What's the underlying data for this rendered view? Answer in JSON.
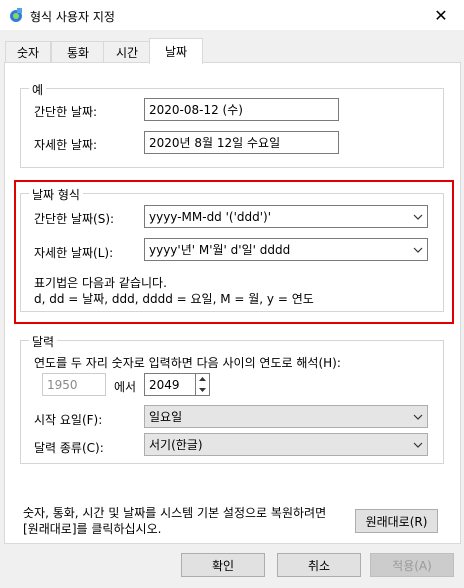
{
  "window": {
    "title": "형식 사용자 지정",
    "close_icon": "close-icon"
  },
  "tabs": [
    {
      "label": "숫자",
      "active": false
    },
    {
      "label": "통화",
      "active": false
    },
    {
      "label": "시간",
      "active": false
    },
    {
      "label": "날짜",
      "active": true
    }
  ],
  "example": {
    "legend": "예",
    "short_label": "간단한 날짜:",
    "short_value": "2020-08-12 (수)",
    "long_label": "자세한 날짜:",
    "long_value": "2020년 8월 12일 수요일"
  },
  "date_format": {
    "legend": "날짜 형식",
    "short_label": "간단한 날짜(S):",
    "short_value": "yyyy-MM-dd '('ddd')'",
    "long_label": "자세한 날짜(L):",
    "long_value": "yyyy'년' M'월' d'일' dddd",
    "notation_line1": "표기법은 다음과 같습니다.",
    "notation_line2": "d, dd = 날짜,  ddd, dddd = 요일,  M = 월,  y = 연도"
  },
  "calendar": {
    "legend": "달력",
    "two_digit_label": "연도를 두 자리 숫자로 입력하면 다음 사이의 연도로 해석(H):",
    "year_from": "1950",
    "year_between": "에서",
    "year_to": "2049",
    "first_day_label": "시작 요일(F):",
    "first_day_value": "일요일",
    "calendar_type_label": "달력 종류(C):",
    "calendar_type_value": "서기(한글)"
  },
  "reset": {
    "text_line1": "숫자, 통화, 시간 및 날짜를 시스템 기본 설정으로 복원하려면",
    "text_line2": "[원래대로]를 클릭하십시오.",
    "button": "원래대로(R)"
  },
  "footer": {
    "ok": "확인",
    "cancel": "취소",
    "apply": "적용(A)"
  }
}
